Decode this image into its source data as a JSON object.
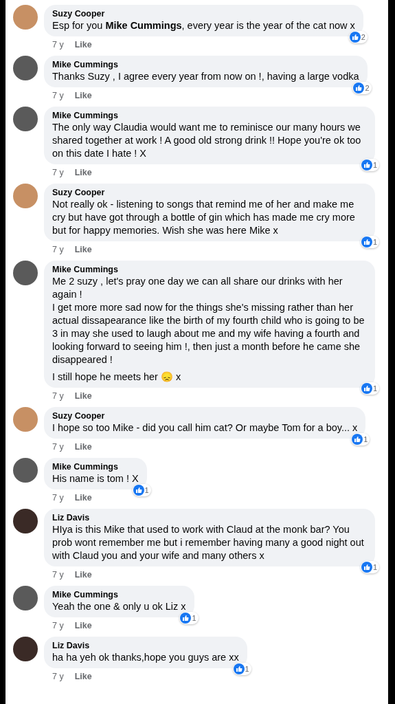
{
  "comments": [
    {
      "author": "Suzy Cooper",
      "color": "#c79064",
      "paragraphs": [
        "Esp for you **Mike Cummings**, every year is the year of the cat now x"
      ],
      "time": "7 y",
      "action": "Like",
      "reactions": "2"
    },
    {
      "author": "Mike Cummings",
      "color": "#5a5a5a",
      "paragraphs": [
        "Thanks Suzy , I agree every year from now on !, having a large vodka"
      ],
      "time": "7 y",
      "action": "Like",
      "reactions": "2"
    },
    {
      "author": "Mike Cummings",
      "color": "#5a5a5a",
      "paragraphs": [
        "The only way Claudia would want me to reminisce our many hours we shared together at work ! A good old strong drink !! Hope you're ok too on this date I hate ! X"
      ],
      "time": "7 y",
      "action": "Like",
      "reactions": "1"
    },
    {
      "author": "Suzy Cooper",
      "color": "#c79064",
      "paragraphs": [
        "Not really ok - listening to songs that remind me of her and make me cry but have got through a bottle of gin which has made me cry more but for happy memories. Wish she was here Mike x"
      ],
      "time": "7 y",
      "action": "Like",
      "reactions": "1"
    },
    {
      "author": "Mike Cummings",
      "color": "#5a5a5a",
      "paragraphs": [
        "Me 2 suzy , let's pray one day we can all  share our drinks with her again !\nI get more more sad now for the things she's missing rather than her actual  dissapearance  like the birth of my fourth child who is going to be 3 in may she used to laugh about me and my wife having a fourth and looking forward to seeing him !, then just a month before he came she disappeared !",
        "I still hope he meets her 😞 x"
      ],
      "time": "7 y",
      "action": "Like",
      "reactions": "1"
    },
    {
      "author": "Suzy Cooper",
      "color": "#c79064",
      "paragraphs": [
        "I hope so too Mike - did you call him cat? Or maybe Tom for a boy... x"
      ],
      "time": "7 y",
      "action": "Like",
      "reactions": "1"
    },
    {
      "author": "Mike Cummings",
      "color": "#5a5a5a",
      "paragraphs": [
        "His name is tom ! X"
      ],
      "time": "7 y",
      "action": "Like",
      "reactions": "1"
    },
    {
      "author": "Liz Davis",
      "color": "#3a2a26",
      "paragraphs": [
        "HIya is this Mike that used to work with Claud at the monk bar? You prob wont remember me but i remember having many a good night out with Claud you and your wife and many others x"
      ],
      "time": "7 y",
      "action": "Like",
      "reactions": "1"
    },
    {
      "author": "Mike Cummings",
      "color": "#5a5a5a",
      "paragraphs": [
        "Yeah the one & only u ok Liz x"
      ],
      "time": "7 y",
      "action": "Like",
      "reactions": "1"
    },
    {
      "author": "Liz Davis",
      "color": "#3a2a26",
      "paragraphs": [
        "ha ha yeh ok thanks,hope you guys are xx"
      ],
      "time": "7 y",
      "action": "Like",
      "reactions": "1"
    }
  ]
}
